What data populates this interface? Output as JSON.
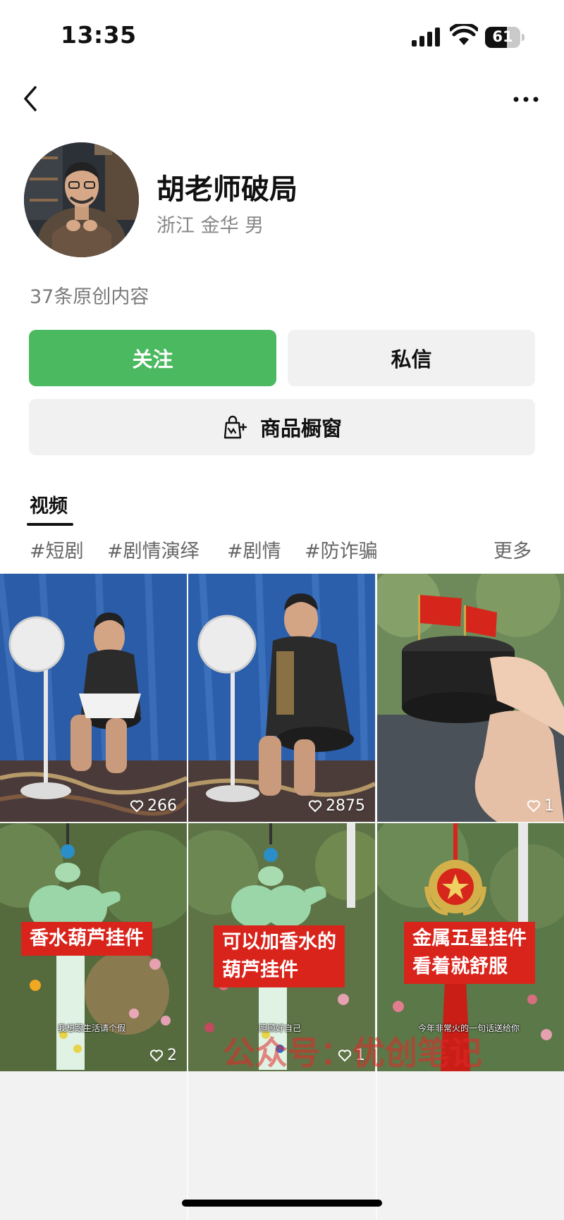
{
  "status_bar": {
    "time": "13:35",
    "battery": "61",
    "battery_level": 0.61
  },
  "profile": {
    "name": "胡老师破局",
    "meta": "浙江 金华 男",
    "post_count": "37条原创内容"
  },
  "actions": {
    "follow": "关注",
    "message": "私信",
    "shop": "商品橱窗"
  },
  "tabs": {
    "video": "视频"
  },
  "tags": [
    "#短剧",
    "#剧情演绎",
    "#剧情",
    "#防诈骗"
  ],
  "tags_more": "更多",
  "videos": [
    {
      "likes": "266"
    },
    {
      "likes": "2875"
    },
    {
      "likes": "1"
    },
    {
      "likes": "2",
      "caption": "香水葫芦挂件",
      "subtitle": "我想跟生活请个假"
    },
    {
      "likes": "1",
      "caption_line1": "可以加香水的",
      "caption_line2": "葫芦挂件",
      "subtitle": "照顾好自己"
    },
    {
      "caption_line1": "金属五星挂件",
      "caption_line2": "看着就舒服",
      "subtitle": "今年非常火的一句话送给你"
    }
  ],
  "watermark": "公众号：优创笔记",
  "colors": {
    "follow_button": "#4ab95f",
    "secondary_button": "#f1f1f1",
    "caption_red": "#d9241c"
  }
}
